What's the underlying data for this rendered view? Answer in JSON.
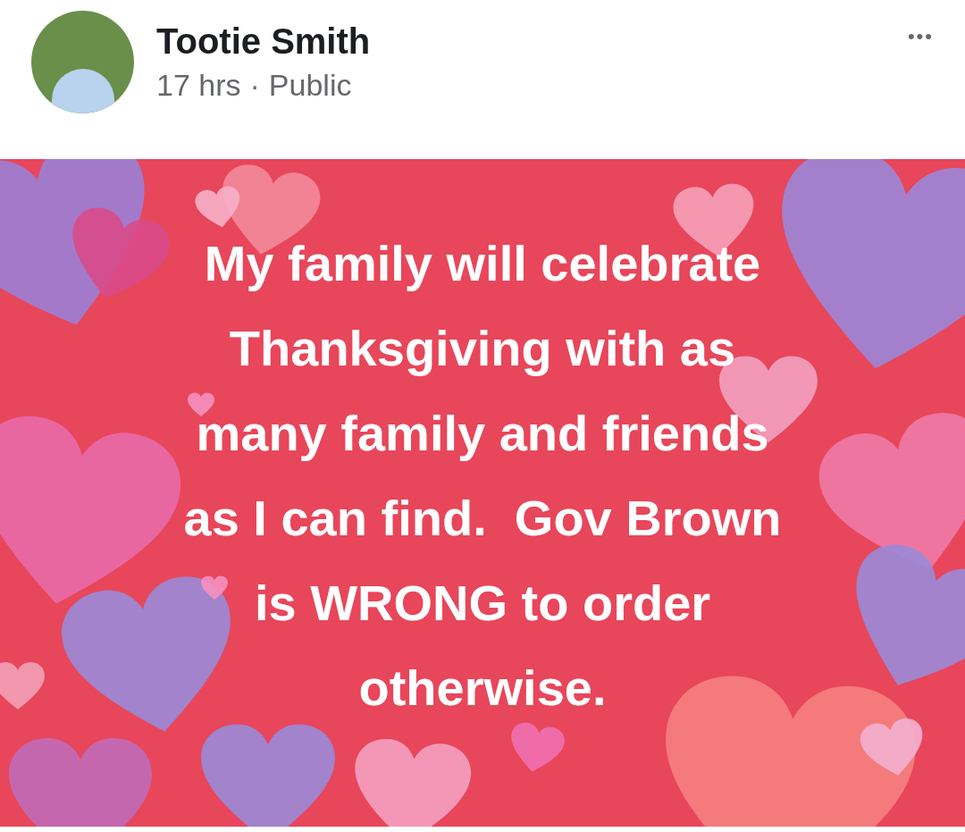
{
  "post": {
    "author": "Tootie Smith",
    "time": "17 hrs",
    "separator": "·",
    "audience": "Public",
    "menu": "•••",
    "background": {
      "kind": "hearts"
    },
    "lines": [
      "My family will celebrate",
      "Thanksgiving with as",
      "many family and friends",
      "as I can find.  Gov Brown",
      "is WRONG to order",
      "otherwise."
    ]
  }
}
